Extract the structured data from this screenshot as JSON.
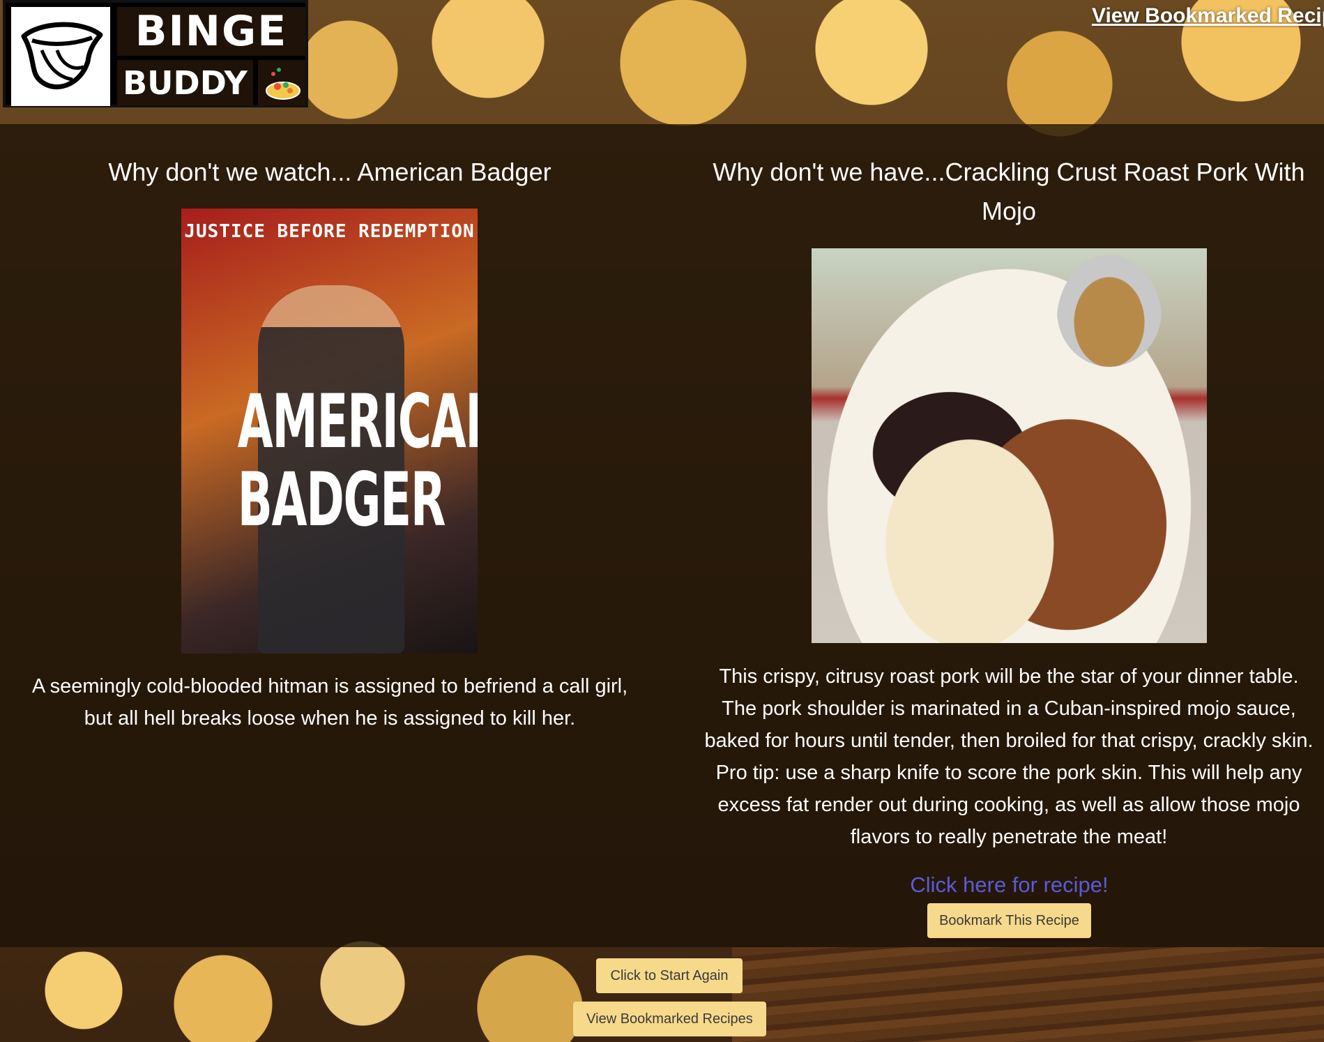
{
  "header": {
    "logo": {
      "word1": "BINGE",
      "word2": "BUDDY"
    },
    "nav_link": "View Bookmarked Recipes"
  },
  "movie": {
    "heading": "Why don't we watch... American Badger",
    "poster": {
      "tagline": "JUSTICE BEFORE REDEMPTION",
      "title_line1": "AMERICAN",
      "title_line2": "BADGER"
    },
    "description": "A seemingly cold-blooded hitman is assigned to befriend a call girl, but all hell breaks loose when he is assigned to kill her."
  },
  "recipe": {
    "heading": "Why don't we have...Crackling Crust Roast Pork With Mojo",
    "description": "This crispy, citrusy roast pork will be the star of your dinner table. The pork shoulder is marinated in a Cuban-inspired mojo sauce, baked for hours until tender, then broiled for that crispy, crackly skin. Pro tip: use a sharp knife to score the pork skin. This will help any excess fat render out during cooking, as well as allow those mojo flavors to really penetrate the meat!",
    "link_text": "Click here for recipe!",
    "bookmark_button": "Bookmark This Recipe"
  },
  "footer": {
    "start_again_button": "Click to Start Again",
    "view_bookmarks_button": "View Bookmarked Recipes"
  },
  "colors": {
    "button_bg": "#f7d98b",
    "link": "#5b5bd6",
    "overlay": "rgba(28,18,6,0.78)"
  }
}
